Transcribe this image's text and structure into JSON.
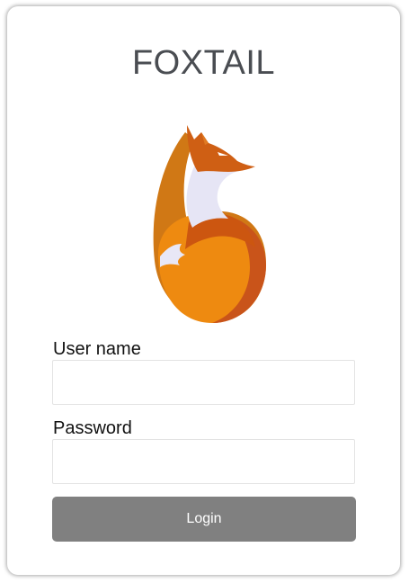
{
  "app": {
    "title": "FOXTAIL",
    "logo_icon": "fox-logo"
  },
  "form": {
    "username_label": "User name",
    "username_value": "",
    "password_label": "Password",
    "password_value": "",
    "login_label": "Login"
  },
  "colors": {
    "button": "#808080",
    "fox_orange": "#ef8b12",
    "fox_dark": "#cc5a12",
    "fox_white": "#e6e5f5"
  }
}
